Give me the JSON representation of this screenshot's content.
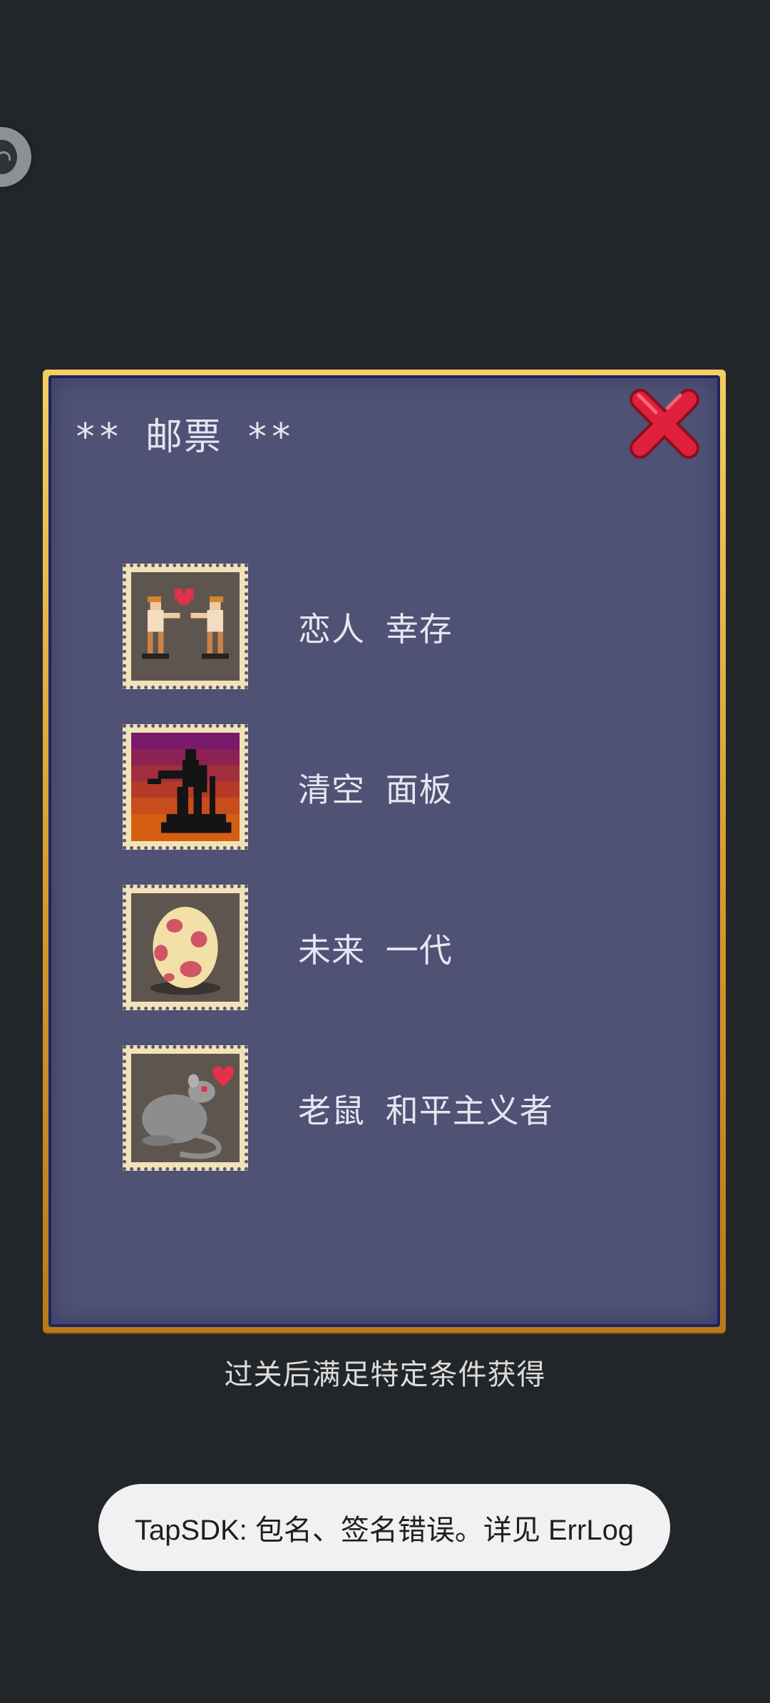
{
  "dialog": {
    "title": "** 邮票 **",
    "close_icon": "close-x-icon"
  },
  "stamps": [
    {
      "label": "恋人 幸存",
      "icon": "lovers-stamp-icon"
    },
    {
      "label": "清空 面板",
      "icon": "silhouette-sunset-stamp-icon"
    },
    {
      "label": "未来 一代",
      "icon": "spotted-egg-stamp-icon"
    },
    {
      "label": "老鼠 和平主义者",
      "icon": "rat-heart-stamp-icon"
    }
  ],
  "hint": "过关后满足特定条件获得",
  "toast": {
    "message": "TapSDK: 包名、签名错误。详见 ErrLog"
  },
  "floating_button": {
    "icon": "assistant-ball-icon"
  },
  "colors": {
    "background": "#232629",
    "panel": "#4f5175",
    "frame_gold": "#d49a2c",
    "close_red": "#e0213b",
    "stamp_paper": "#f1e3b8"
  }
}
